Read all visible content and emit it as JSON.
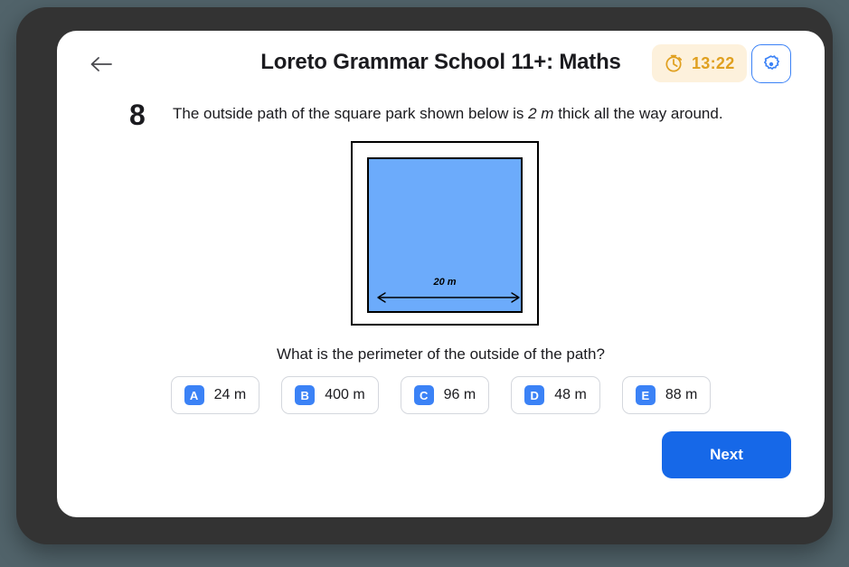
{
  "header": {
    "back_icon": "arrow-left-icon",
    "title": "Loreto Grammar School 11+: Maths",
    "timer": {
      "icon": "stopwatch-icon",
      "value": "13:22",
      "bg": "#fdf1dc",
      "fg": "#e0a020"
    },
    "settings": {
      "icon": "gear-icon",
      "color": "#3b82f6"
    }
  },
  "question": {
    "number": "8",
    "text_before": "The outside path of the square park shown below is ",
    "text_emphasis": "2 m",
    "text_after": " thick all the way around.",
    "prompt": "What is the perimeter of the outside of the path?"
  },
  "diagram": {
    "dimension_label": "20 m",
    "inner_fill": "#6cabfb",
    "stroke": "#000000"
  },
  "options": [
    {
      "letter": "A",
      "label": "24 m"
    },
    {
      "letter": "B",
      "label": "400 m"
    },
    {
      "letter": "C",
      "label": "96 m"
    },
    {
      "letter": "D",
      "label": "48 m"
    },
    {
      "letter": "E",
      "label": "88 m"
    }
  ],
  "footer": {
    "next_label": "Next",
    "next_color": "#1668e8"
  }
}
